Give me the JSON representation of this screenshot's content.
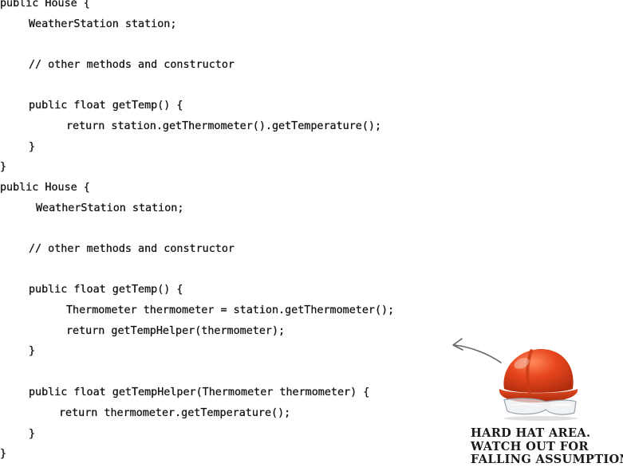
{
  "code": {
    "block1": [
      "public House {",
      "WeatherStation station;",
      "// other methods and constructor",
      "public float getTemp() {",
      "return station.getThermometer().getTemperature();",
      "}",
      "}"
    ],
    "block2": [
      "public House {",
      "WeatherStation station;",
      "// other methods and constructor",
      "public float getTemp() {",
      "Thermometer thermometer = station.getThermometer();",
      "return getTempHelper(thermometer);",
      "}",
      "public float getTempHelper(Thermometer thermometer) {",
      "return thermometer.getTemperature();",
      "}",
      "}"
    ]
  },
  "annotation": {
    "icon": "hard-hat-icon",
    "lines": [
      "HARD HAT AREA.",
      "WATCH OUT FOR",
      "FALLING ASSUMPTIONS"
    ]
  },
  "colors": {
    "code_text": "#111111",
    "hat_orange": "#e8471f",
    "arrow": "#666666"
  }
}
